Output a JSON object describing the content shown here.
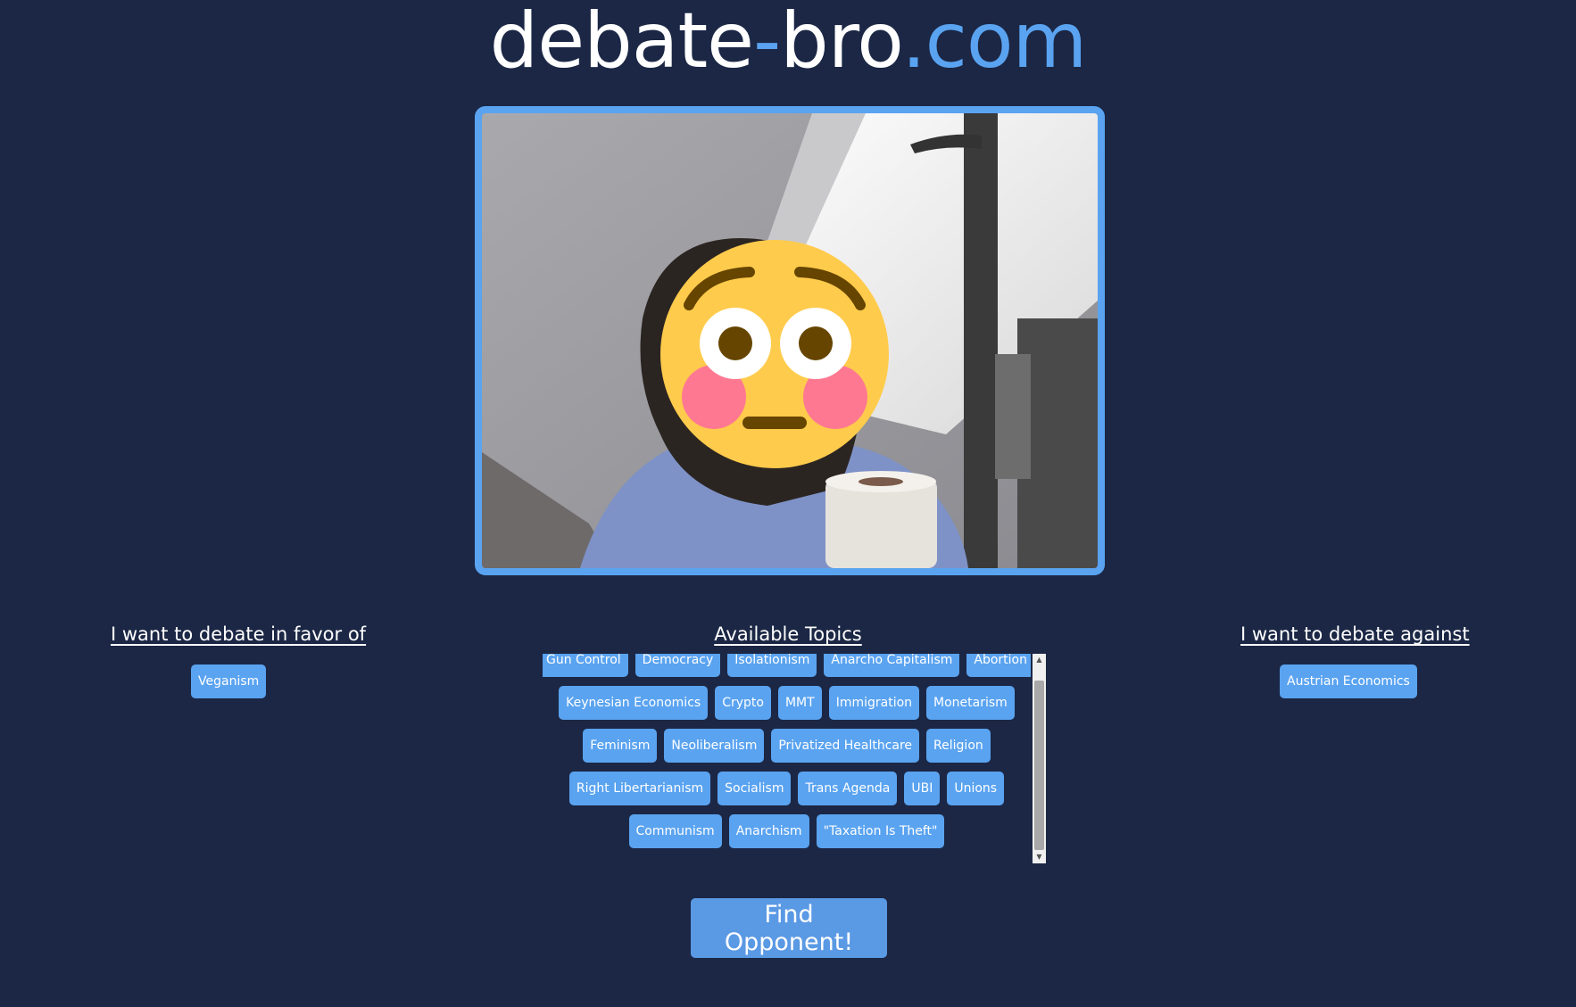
{
  "logo": {
    "part1": "debate",
    "hyphen": "-",
    "part2": "bro",
    "tld": ".com"
  },
  "colors": {
    "background": "#1b2745",
    "accent": "#5aa3f0",
    "button": "#5a99e4"
  },
  "video": {
    "overlay_icon": "flushed-face-emoji-icon"
  },
  "favor": {
    "heading": "I want to debate in favor of",
    "selected": [
      "Veganism"
    ]
  },
  "against": {
    "heading": "I want to debate against",
    "selected": [
      "Austrian Economics"
    ]
  },
  "topics": {
    "heading": "Available Topics",
    "rows": [
      [
        "Gun Control",
        "Democracy",
        "Isolationism",
        "Anarcho Capitalism",
        "Abortion"
      ],
      [
        "Keynesian Economics",
        "Crypto",
        "MMT",
        "Immigration",
        "Monetarism"
      ],
      [
        "Feminism",
        "Neoliberalism",
        "Privatized Healthcare",
        "Religion"
      ],
      [
        "Right Libertarianism",
        "Socialism",
        "Trans Agenda",
        "UBI",
        "Unions"
      ],
      [
        "Communism",
        "Anarchism",
        "\"Taxation Is Theft\""
      ]
    ]
  },
  "find_button": {
    "label": "Find Opponent!"
  }
}
